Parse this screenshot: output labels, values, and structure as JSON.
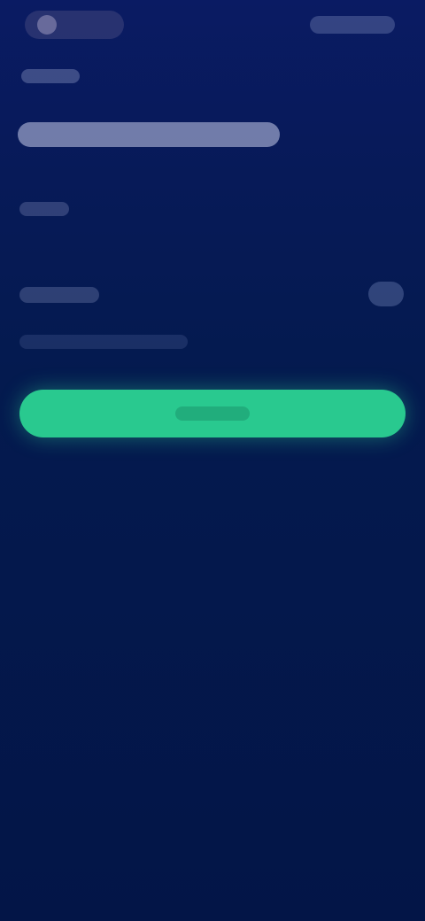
{
  "theme": {
    "background": "#031647",
    "header_background": "#0a1b63",
    "accent": "#29c98f"
  },
  "icons": {
    "logo": "app-logo-icon"
  }
}
